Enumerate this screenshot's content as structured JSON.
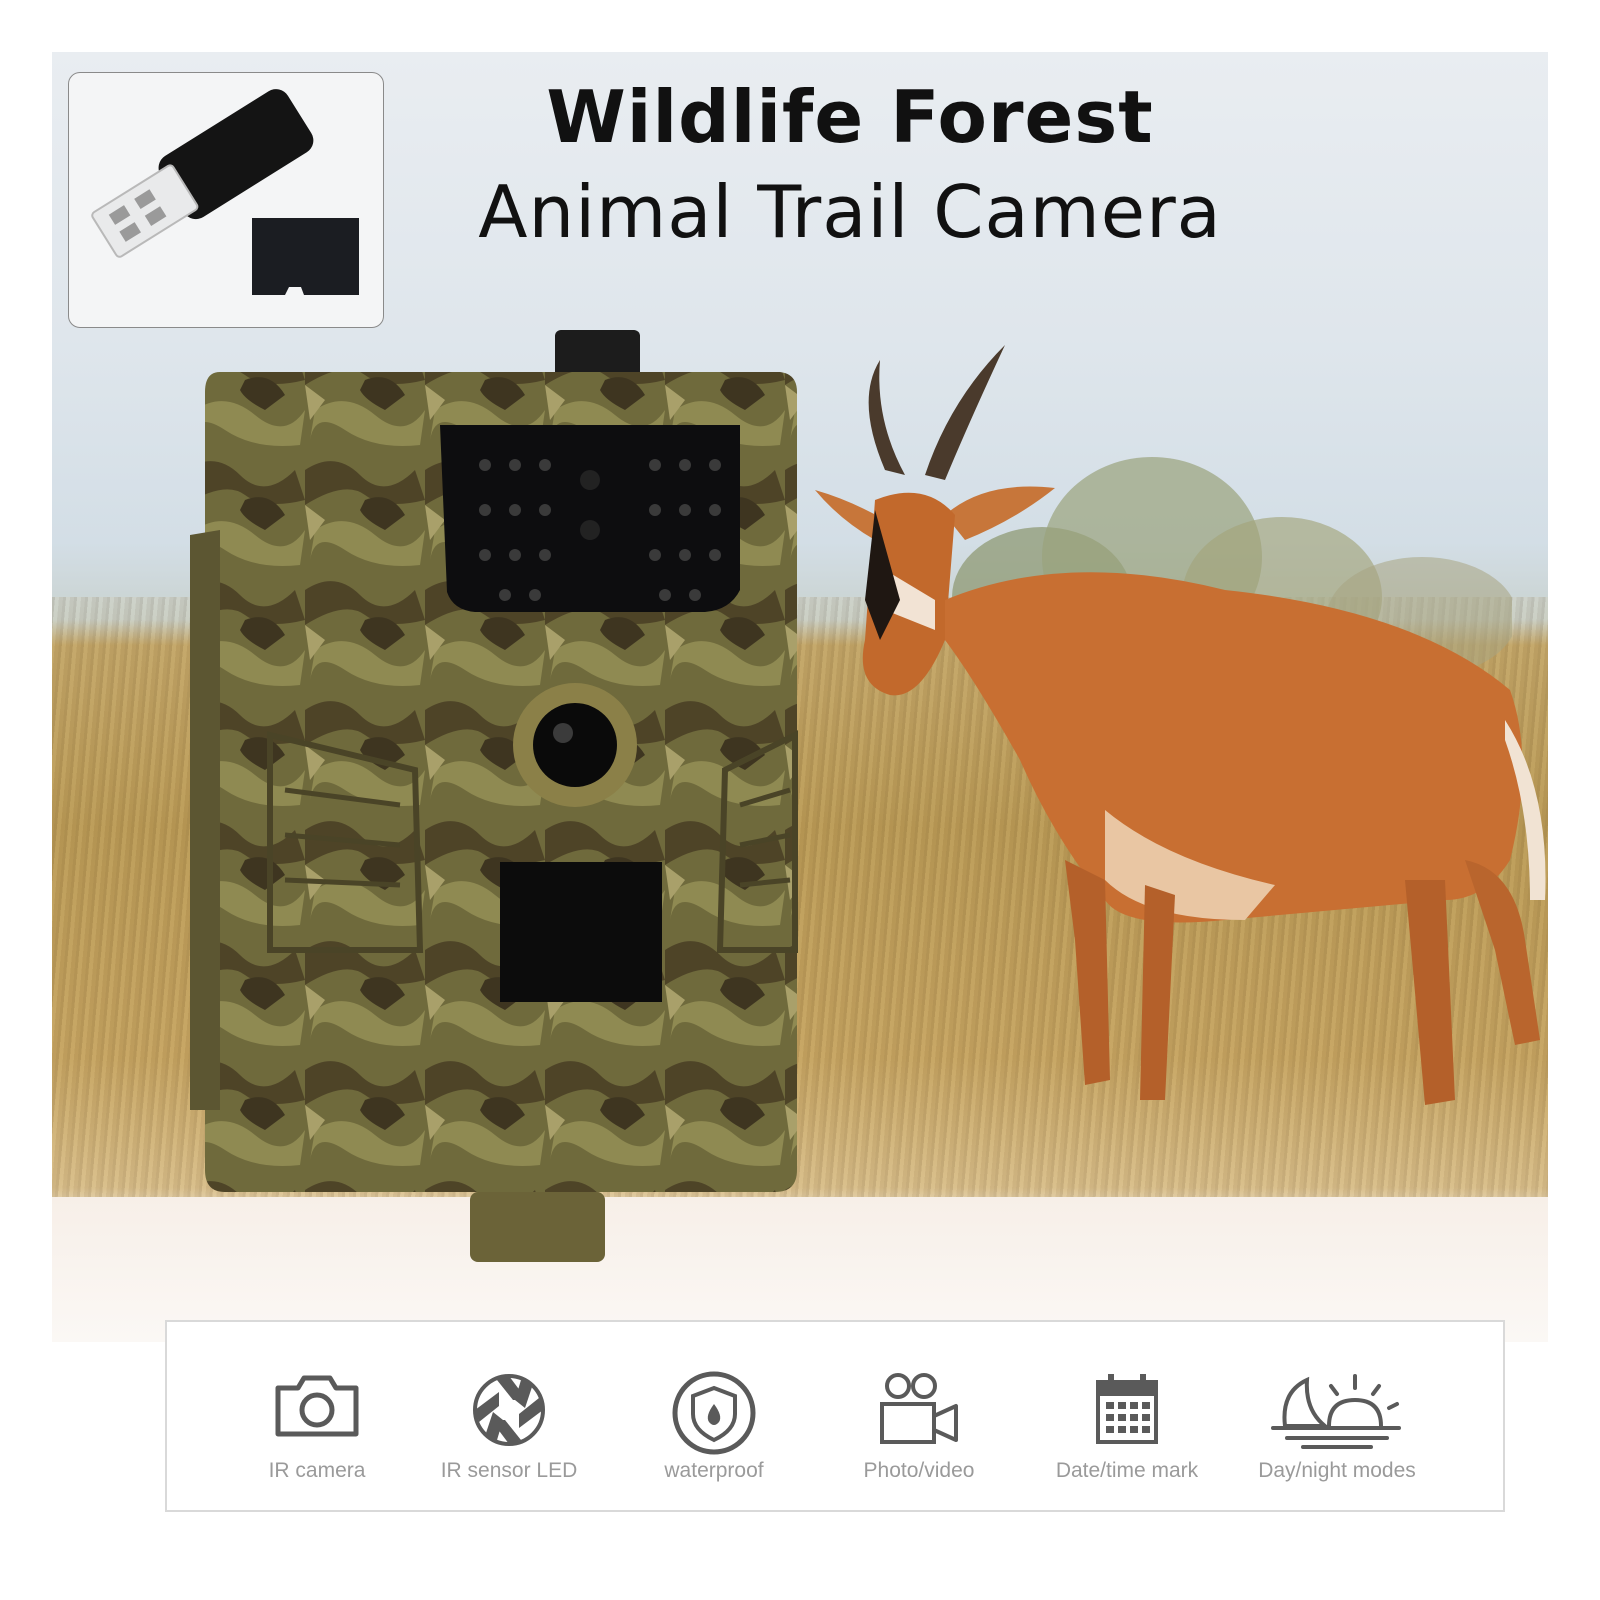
{
  "title": {
    "line1": "Wildlife Forest",
    "line2": "Animal Trail Camera"
  },
  "accessories": {
    "items": [
      "usb-card-reader-icon",
      "micro-sd-card-icon"
    ]
  },
  "product": {
    "image": "camouflage-trail-camera",
    "subject": "antelope-in-grassland"
  },
  "features": [
    {
      "label": "IR camera",
      "icon": "camera-icon"
    },
    {
      "label": "IR sensor LED",
      "icon": "aperture-icon"
    },
    {
      "label": "waterproof",
      "icon": "shield-drop-icon"
    },
    {
      "label": "Photo/video",
      "icon": "video-camera-icon"
    },
    {
      "label": "Date/time mark",
      "icon": "calendar-icon"
    },
    {
      "label": "Day/night modes",
      "icon": "day-night-icon"
    }
  ],
  "colors": {
    "icon_gray": "#5a5a5a",
    "label_gray": "#9a9a9a",
    "camo_base": "#6b6b3a"
  }
}
